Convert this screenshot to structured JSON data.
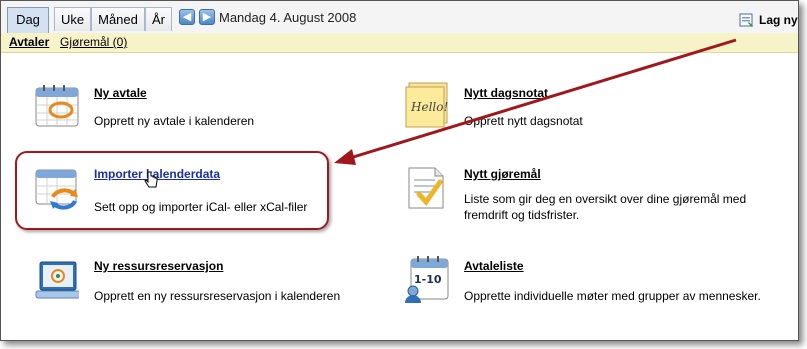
{
  "tabs": [
    {
      "label": "Dag",
      "active": true
    },
    {
      "label": "Uke",
      "active": false
    },
    {
      "label": "Måned",
      "active": false
    },
    {
      "label": "År",
      "active": false
    }
  ],
  "nav": {
    "prev_icon": "arrow-left-icon",
    "next_icon": "arrow-right-icon",
    "prev_glyph": "◀",
    "next_glyph": "▶"
  },
  "date": "Mandag 4. August 2008",
  "lag_ny": "Lag ny",
  "subtabs": {
    "avtaler": "Avtaler",
    "gjoremal": "Gjøremål (0)"
  },
  "items": {
    "ny_avtale": {
      "title": "Ny avtale",
      "desc": "Opprett ny avtale i kalenderen"
    },
    "importer": {
      "title": "Importer kalenderdata",
      "desc": "Sett opp og importer iCal- eller xCal-filer"
    },
    "ressurs": {
      "title": "Ny ressursreservasjon",
      "desc": "Opprett en ny ressursreservasjon i kalenderen"
    },
    "dagsnotat": {
      "title": "Nytt dagsnotat",
      "desc": "Opprett nytt dagsnotat",
      "note_text": "Hello!"
    },
    "gjoremal": {
      "title": "Nytt gjøremål",
      "desc": "Liste som gir deg en oversikt over dine gjøremål med fremdrift og tidsfrister."
    },
    "avtaleliste": {
      "title": "Avtaleliste",
      "desc": "Opprette individuelle møter med grupper av mennesker.",
      "icon_text": "1-10"
    }
  },
  "colors": {
    "callout": "#a0181c",
    "subbar": "#f7f3c9",
    "link_blue": "#1a2fa6"
  }
}
